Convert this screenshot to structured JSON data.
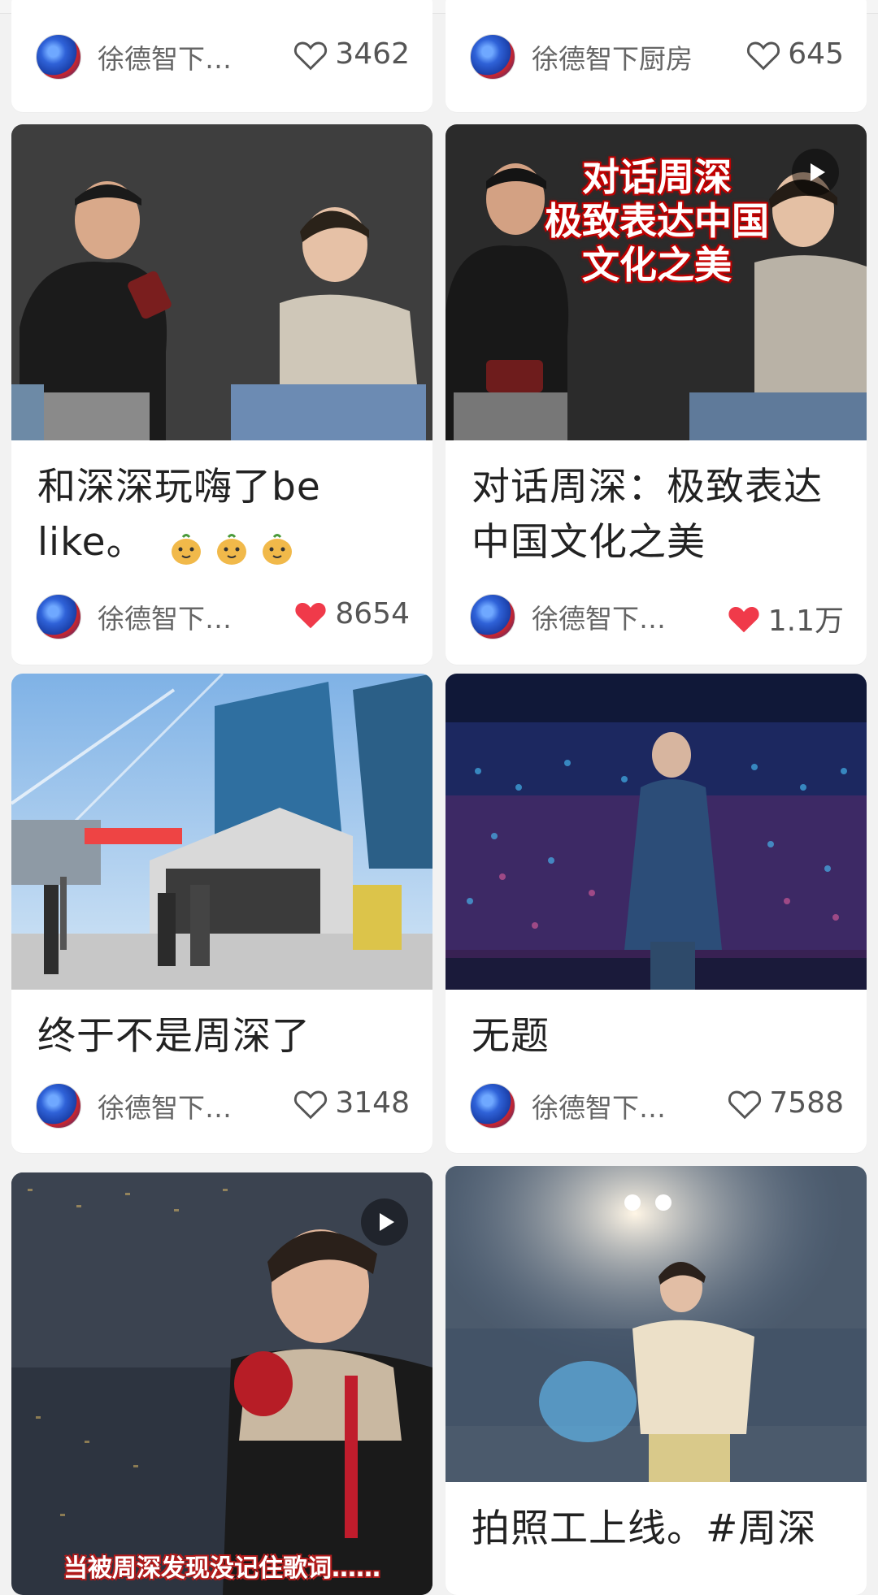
{
  "feed": {
    "top_row": [
      {
        "author": "徐德智下…",
        "likes": "3462",
        "liked": false
      },
      {
        "author": "徐德智下厨房",
        "likes": "645",
        "liked": false
      }
    ],
    "posts": [
      {
        "title": "和深深玩嗨了be like。",
        "emoji_count": 3,
        "author": "徐德智下…",
        "likes": "8654",
        "liked": true,
        "is_video": false,
        "image_desc": "interview-scene"
      },
      {
        "title": "对话周深：极致表达中国文化之美",
        "author": "徐德智下…",
        "likes": "1.1万",
        "liked": true,
        "is_video": true,
        "overlay": [
          "对话周深",
          "极致表达中国",
          "文化之美"
        ],
        "image_desc": "interview-video"
      },
      {
        "title": "终于不是周深了",
        "author": "徐德智下…",
        "likes": "3148",
        "liked": false,
        "is_video": false,
        "image_desc": "un-headquarters"
      },
      {
        "title": "无题",
        "author": "徐德智下…",
        "likes": "7588",
        "liked": false,
        "is_video": false,
        "image_desc": "concert-stage"
      },
      {
        "title": "",
        "author": "",
        "likes": "",
        "liked": false,
        "is_video": true,
        "caption": "当被周深发现没记住歌词……",
        "image_desc": "concert-performer-video"
      },
      {
        "title": "拍照工上线。#周深",
        "author": "",
        "likes": "",
        "liked": false,
        "is_video": false,
        "image_desc": "concert-performer-photo"
      }
    ]
  },
  "colors": {
    "like_active": "#f03a4a",
    "text_primary": "#222222",
    "text_secondary": "#666666",
    "background": "#f2f2f2"
  }
}
